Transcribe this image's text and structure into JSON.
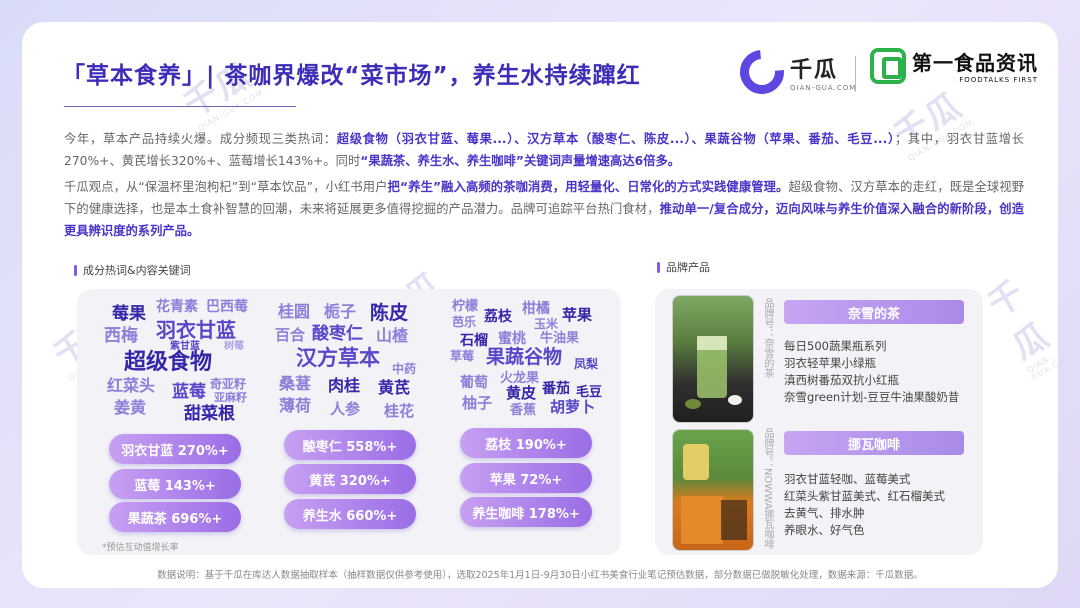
{
  "header": {
    "title": "「草本食养」| 茶咖界爆改“菜市场”，养生水持续蹿红",
    "logo_qg_name": "千瓜",
    "logo_qg_sub": "QIAN-GUA.COM",
    "logo_ft_name": "第一食品资讯",
    "logo_ft_sub": "FOODTALKS FIRST"
  },
  "watermark": {
    "name": "千瓜",
    "sub": "QIAN-GUA.COM"
  },
  "intro": {
    "p1_a": "今年，草本产品持续火爆。成分频现三类热词：",
    "p1_b": "超级食物（羽衣甘蓝、莓果...）、汉方草本（酸枣仁、陈皮...）、果蔬谷物（苹果、番茄、毛豆...）",
    "p1_c": "；其中，羽衣甘蓝增长270%+、黄芪增长320%+、蓝莓增长143%+。同时",
    "p1_d": "“果蔬茶、养生水、养生咖啡”关键词声量增速高达6倍多。",
    "p2_a": "千瓜观点，从“保温杯里泡枸杞”到“草本饮品”，小红书用户",
    "p2_b": "把“养生”融入高频的茶咖消费，用轻量化、日常化的方式实践健康管理。",
    "p2_c": "超级食物、汉方草本的走红，既是全球视野下的健康选择，也是本土食补智慧的回潮，未来将延展更多值得挖掘的产品潜力。品牌可追踪平台热门食材，",
    "p2_d": "推动单一/复合成分，迈向风味与养生价值深入融合的新阶段，创造更具辨识度的系列产品。"
  },
  "section_left_title": "成分热词&内容关键词",
  "section_right_title": "品牌产品",
  "wordclouds": [
    {
      "words": [
        "莓果",
        "花青素",
        "巴西莓",
        "西梅",
        "羽衣甘蓝",
        "紫甘蓝",
        "树莓",
        "超级食物",
        "红菜头",
        "蓝莓",
        "奇亚籽",
        "亚麻籽",
        "姜黄",
        "甜菜根"
      ],
      "pills": [
        "羽衣甘蓝 270%+",
        "蓝莓 143%+",
        "果蔬茶 696%+"
      ]
    },
    {
      "words": [
        "桂圆",
        "栀子",
        "陈皮",
        "百合",
        "酸枣仁",
        "山楂",
        "汉方草本",
        "中药",
        "桑葚",
        "肉桂",
        "黄芪",
        "薄荷",
        "人参",
        "桂花"
      ],
      "pills": [
        "酸枣仁 558%+",
        "黄芪 320%+",
        "养生水 660%+"
      ]
    },
    {
      "words": [
        "柠檬",
        "芭乐",
        "荔枝",
        "柑橘",
        "苹果",
        "玉米",
        "牛油果",
        "草莓",
        "石榴",
        "蜜桃",
        "果蔬谷物",
        "凤梨",
        "葡萄",
        "火龙果",
        "黄皮",
        "番茄",
        "毛豆",
        "柚子",
        "香蕉",
        "胡萝卜"
      ],
      "pills": [
        "荔枝 190%+",
        "苹果 72%+",
        "养生咖啡 178%+"
      ]
    }
  ],
  "note": "*预估互动值增长率",
  "brands": [
    {
      "name": "奈雪的茶",
      "account": "品牌号：奈雪的茶",
      "products": [
        "每日500蔬果瓶系列",
        "羽衣轻苹果小绿瓶",
        "滇西树番茄双抗小红瓶",
        "奈雪green计划-豆豆牛油果酸奶昔"
      ]
    },
    {
      "name": "挪瓦咖啡",
      "account": "品牌号：NOWWA挪瓦咖啡",
      "products": [
        "羽衣甘蓝轻咖、蓝莓美式",
        "红菜头紫甘蓝美式、红石榴美式",
        "去黄气、排水肿",
        "养眼水、好气色"
      ]
    }
  ],
  "footer": "数据说明：基于千瓜在库达人数据抽取样本（抽样数据仅供参考使用），选取2025年1月1日-9月30日小红书美食行业笔记预估数据，部分数据已做脱敏化处理，数据来源：千瓜数据。",
  "colors": {
    "accent": "#3d2db8",
    "pill": "#a77aea",
    "green": "#2db24b"
  }
}
